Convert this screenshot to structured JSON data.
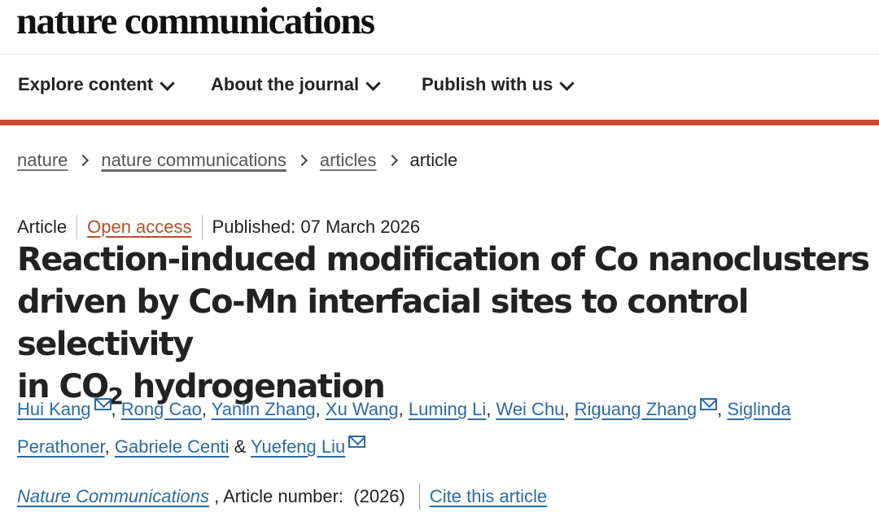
{
  "site": {
    "logo": "nature communications"
  },
  "nav": {
    "items": [
      {
        "label": "Explore content"
      },
      {
        "label": "About the journal"
      },
      {
        "label": "Publish with us"
      }
    ]
  },
  "breadcrumb": {
    "items": [
      {
        "label": "nature"
      },
      {
        "label": "nature communications"
      },
      {
        "label": "articles"
      }
    ],
    "current": "article"
  },
  "meta": {
    "type": "Article",
    "access": "Open access",
    "published": "Published: 07 March 2026"
  },
  "article": {
    "title_line1": "Reaction-induced modification of Co nanoclusters",
    "title_line2": "driven by Co-Mn interfacial sites to control selectivity",
    "title_line3_pre": "in CO",
    "title_line3_sub": "2",
    "title_line3_post": " hydrogenation",
    "authors": [
      {
        "name": "Hui Kang",
        "sep": ", "
      },
      {
        "name": "Rong Cao",
        "sep": ", "
      },
      {
        "name": "Yanlin Zhang",
        "sep": ", "
      },
      {
        "name": "Xu Wang",
        "sep": ", "
      },
      {
        "name": "Luming Li",
        "sep": ", "
      },
      {
        "name": "Wei Chu",
        "sep": ", "
      },
      {
        "name": "Riguang Zhang",
        "sep": ", "
      },
      {
        "name": "Siglinda Perathoner",
        "sep": ", "
      },
      {
        "name": "Gabriele Centi",
        "sep": " & "
      },
      {
        "name": "Yuefeng Liu"
      }
    ]
  },
  "citation": {
    "journal": "Nature Communications",
    "number_text": " , Article number:  (2026)",
    "cite_label": "Cite this article"
  },
  "icons": {
    "nav_chevron": "chevron-down-icon",
    "breadcrumb_separator": "chevron-right-icon",
    "author_contact": "mail-icon"
  },
  "colors": {
    "accent_bar": "#cc4b37",
    "open_access": "#b2502f",
    "link": "#2d6aa2"
  }
}
